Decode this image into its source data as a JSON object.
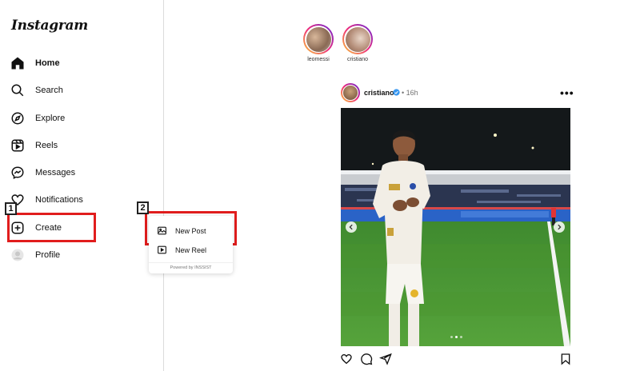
{
  "app": {
    "logo_text": "Instagram"
  },
  "sidebar": {
    "items": [
      {
        "label": "Home",
        "icon": "home-icon"
      },
      {
        "label": "Search",
        "icon": "search-icon"
      },
      {
        "label": "Explore",
        "icon": "compass-icon"
      },
      {
        "label": "Reels",
        "icon": "reels-icon"
      },
      {
        "label": "Messages",
        "icon": "messenger-icon"
      },
      {
        "label": "Notifications",
        "icon": "heart-icon"
      },
      {
        "label": "Create",
        "icon": "plus-square-icon"
      },
      {
        "label": "Profile",
        "icon": "avatar-icon"
      }
    ]
  },
  "create_menu": {
    "items": [
      {
        "label": "New Post",
        "icon": "image-icon"
      },
      {
        "label": "New Reel",
        "icon": "reel-play-icon"
      }
    ],
    "footer": "Powered by INSSIST"
  },
  "annotations": {
    "step1": "1",
    "step2": "2",
    "color": "#e11d1d"
  },
  "stories": [
    {
      "name": "leomessi"
    },
    {
      "name": "cristiano"
    }
  ],
  "post": {
    "username": "cristiano",
    "separator": "•",
    "time": "16h",
    "more": "•••",
    "carousel_dots": 3,
    "active_dot": 1
  },
  "colors": {
    "border": "#dbdbdb",
    "verified": "#3897f0",
    "story_ring": "#ee2a7b"
  }
}
